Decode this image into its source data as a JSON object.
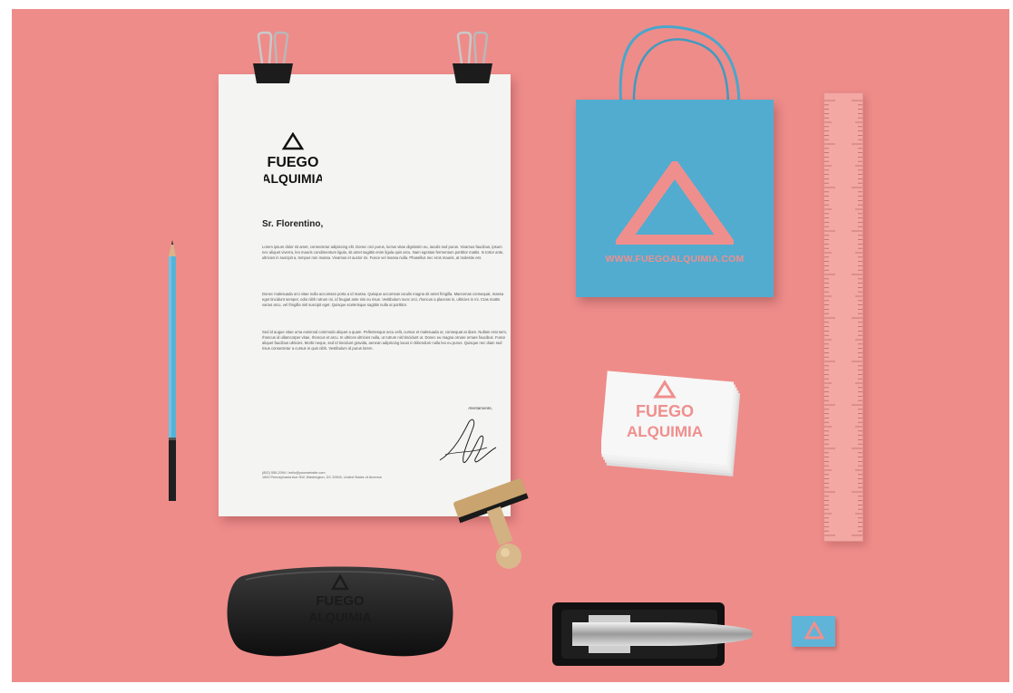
{
  "scene": {
    "background_color": "#ee8c8a",
    "accent_blue": "#51acd0"
  },
  "letterhead": {
    "logo": {
      "line1": "FUEGO",
      "line2": "ALQUIMIA"
    },
    "greeting": "Sr. Florentino,",
    "paragraphs": [
      "Lorem ipsum dolor sit amet, consectetur adipiscing elit. Donec orci purus, luctus vitae dignissim eu, iaculis sed purus. Vivamus faucibus, ipsum nec aliquet viverra, leo mauris condimentum ligula, sit amet sagittis enim ligula quis arcu. Nam egestas fermentum porttitor mattis. In tortor ante, ultricies in suscipit a, tempus non massa. Vivamus et auctor mi. Fusce vel massa nulla. Phasellus nec eros mauris, at molestie est.",
      "Donec malesuada orci vitae nulla accumsan porta a id massa. Quisque accumsan iaculis magna sit amet fringilla. Maecenas consequat, massa eget tincidunt semper, odio nibh rutrum mi, id feugiat ante nisi eu risus. Vestibulum nunc orci, rhoncus a placerat in, ultricies in mi. Cras mattis varius arcu, vel fringilla nisl suscipit eget. Quisque scelerisque sagittis nulla at porttitor.",
      "Sed id augue vitae urna euismod commodo aliquet a quam. Pellentesque arcu velit, cursus et malesuada ut, consequat at diam. Nullam erat sem, rhoncus id ullamcorper vitae, rhoncus et arcu. In ultrices ultricies nulla, ut rutrum nisl tincidunt ut. Donec eu magna ornare ornare faucibus. Fusce aliquet faucibus ultricies. Morbi neque, sed id tincidunt gravida, aenean adipiscing lacus in bibendum nulla leo eu purus. Quisque nec diam sed risus consectetur a cursus in quis nibh. Vestibulum id purus lorem."
    ],
    "closing": "Atentamente,",
    "footer_line1": "(852) 555-2094 / hello@yourwebsite.com",
    "footer_line2": "1600 Pennsylvania Ave NW, Washington, DC 20500, United States of America"
  },
  "bag": {
    "url": "WWW.FUEGOALQUIMIA.COM",
    "triangle_color": "#ef8f8d"
  },
  "business_cards": {
    "logo": {
      "line1": "FUEGO",
      "line2": "ALQUIMIA"
    }
  },
  "glasses_case": {
    "logo": {
      "line1": "FUEGO",
      "line2": "ALQUIMIA"
    }
  },
  "icons": [
    "binder-clip-icon",
    "pencil-icon",
    "stamp-icon",
    "ruler-icon",
    "stapler-icon",
    "eraser-icon",
    "triangle-logo-icon",
    "signature-icon"
  ]
}
